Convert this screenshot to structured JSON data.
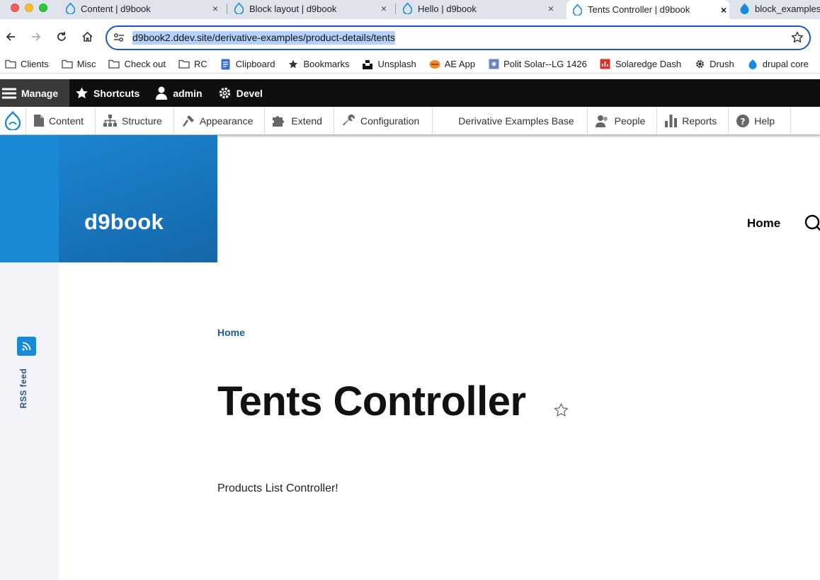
{
  "browser": {
    "tabs": [
      {
        "title": "Content | d9book",
        "active": false
      },
      {
        "title": "Block layout | d9book",
        "active": false
      },
      {
        "title": "Hello | d9book",
        "active": false
      },
      {
        "title": "Tents Controller | d9book",
        "active": true
      },
      {
        "title": "block_examples",
        "active": false
      }
    ],
    "close_glyph": "×",
    "url": "d9book2.ddev.site/derivative-examples/product-details/tents"
  },
  "bookmarks": [
    {
      "label": "Clients",
      "icon": "folder-icon"
    },
    {
      "label": "Misc",
      "icon": "folder-icon"
    },
    {
      "label": "Check out",
      "icon": "folder-icon"
    },
    {
      "label": "RC",
      "icon": "folder-icon"
    },
    {
      "label": "Clipboard",
      "icon": "doc-icon"
    },
    {
      "label": "Bookmarks",
      "icon": "star-icon"
    },
    {
      "label": "Unsplash",
      "icon": "unsplash-icon"
    },
    {
      "label": "AE App",
      "icon": "ae-icon"
    },
    {
      "label": "Polit Solar--LG 1426",
      "icon": "solar-icon"
    },
    {
      "label": "Solaredge Dash",
      "icon": "solaredge-icon"
    },
    {
      "label": "Drush",
      "icon": "gear-icon"
    },
    {
      "label": "drupal core",
      "icon": "drupal-icon"
    }
  ],
  "admin_bar": {
    "manage": "Manage",
    "shortcuts": "Shortcuts",
    "user": "admin",
    "devel": "Devel"
  },
  "admin_tray": [
    {
      "label": "Content",
      "icon": "content-icon"
    },
    {
      "label": "Structure",
      "icon": "structure-icon"
    },
    {
      "label": "Appearance",
      "icon": "appearance-icon"
    },
    {
      "label": "Extend",
      "icon": "extend-icon"
    },
    {
      "label": "Configuration",
      "icon": "wrench-icon"
    },
    {
      "label": "Derivative Examples Base",
      "icon": ""
    },
    {
      "label": "People",
      "icon": "people-icon"
    },
    {
      "label": "Reports",
      "icon": "reports-icon"
    },
    {
      "label": "Help",
      "icon": "help-icon"
    }
  ],
  "site": {
    "name": "d9book",
    "main_nav_home": "Home",
    "rss_label": "RSS feed"
  },
  "page": {
    "breadcrumb": "Home",
    "title": "Tents Controller",
    "body": "Products List Controller!"
  },
  "colors": {
    "brand_blue": "#1a8ad8",
    "link_blue": "#1d5a93",
    "toolbar_black": "#0f0f0f"
  }
}
